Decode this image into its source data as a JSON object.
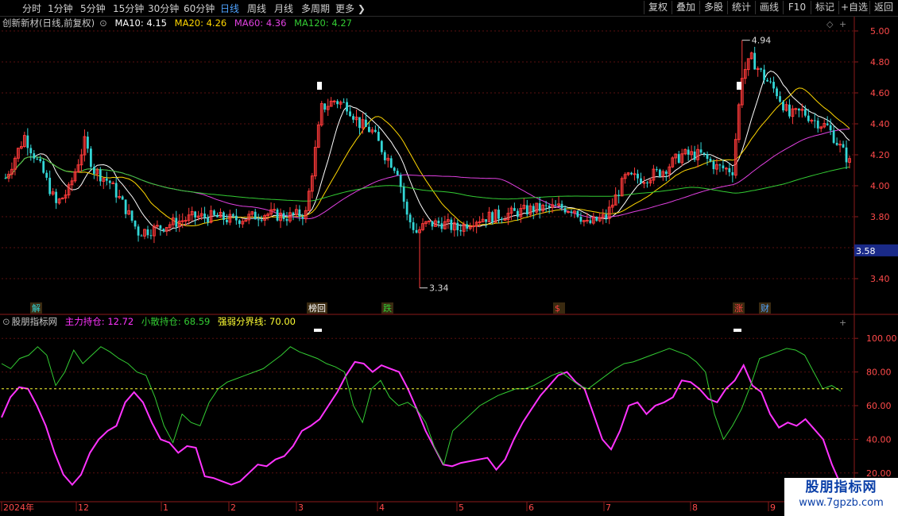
{
  "toolbar": {
    "timeframes": [
      "分时",
      "1分钟",
      "5分钟",
      "15分钟",
      "30分钟",
      "60分钟",
      "日线",
      "周线",
      "月线",
      "多周期",
      "更多"
    ],
    "active_timeframe": "日线",
    "right_buttons": [
      "复权",
      "叠加",
      "多股",
      "统计",
      "画线",
      "F10",
      "标记",
      "+自选",
      "返回"
    ]
  },
  "price_panel": {
    "stock_label": "创新新材(日线,前复权)",
    "ma": [
      {
        "label": "MA10: 4.15",
        "color": "#ffffff"
      },
      {
        "label": "MA20: 4.26",
        "color": "#ffd700"
      },
      {
        "label": "MA60: 4.36",
        "color": "#e040e0"
      },
      {
        "label": "MA120: 4.27",
        "color": "#33cc33"
      }
    ],
    "high_label": "4.94",
    "low_label": "3.34",
    "current_price": "3.58",
    "event_markers": [
      {
        "text": "解",
        "color": "#33d6d6"
      },
      {
        "text": "榜回",
        "color": "#ffffff"
      },
      {
        "text": "跌",
        "color": "#33cc33"
      },
      {
        "text": "$",
        "color": "#ff4040"
      },
      {
        "text": "涨",
        "color": "#ff4040"
      },
      {
        "text": "财",
        "color": "#4fa3ff"
      }
    ]
  },
  "indicator_panel": {
    "title": "股朋指标网",
    "series_labels": [
      {
        "label": "主力持仓: 12.72",
        "color": "#ff33ff"
      },
      {
        "label": "小散持仓: 68.59",
        "color": "#33cc33"
      },
      {
        "label": "强弱分界线: 70.00",
        "color": "#ffff33"
      }
    ]
  },
  "date_axis": [
    "2024年",
    "12",
    "1",
    "2",
    "3",
    "4",
    "5",
    "6",
    "7",
    "8",
    "9"
  ],
  "watermark": {
    "title": "股朋指标网",
    "url": "www.7gpzb.com"
  },
  "chart_data": [
    {
      "type": "candlestick",
      "y_axis_ticks": [
        5.0,
        4.8,
        4.6,
        4.4,
        4.2,
        4.0,
        3.8,
        3.4
      ],
      "ylim": [
        3.34,
        4.94
      ],
      "grid": true,
      "x_labels": [
        "2024年",
        "12",
        "1",
        "2",
        "3",
        "4",
        "5",
        "6",
        "7",
        "8",
        "9"
      ],
      "key_points": [
        {
          "label": "high",
          "value": 4.94
        },
        {
          "label": "low",
          "value": 3.34
        },
        {
          "label": "last",
          "value": 3.58
        }
      ],
      "series": [
        {
          "name": "MA10",
          "last": 4.15
        },
        {
          "name": "MA20",
          "last": 4.26
        },
        {
          "name": "MA60",
          "last": 4.36
        },
        {
          "name": "MA120",
          "last": 4.27
        }
      ]
    },
    {
      "type": "line",
      "y_axis_ticks": [
        100.0,
        80.0,
        60.0,
        40.0,
        20.0
      ],
      "ylim": [
        13,
        108
      ],
      "grid": true,
      "series": [
        {
          "name": "主力持仓",
          "color": "#ff33ff",
          "last": 12.72,
          "values": [
            53,
            65,
            71,
            70,
            60,
            48,
            32,
            19,
            12,
            19,
            32,
            40,
            45,
            48,
            62,
            68,
            62,
            50,
            40,
            38,
            32,
            36,
            35,
            18,
            17,
            15,
            11,
            15,
            20,
            25,
            24,
            28,
            30,
            36,
            45,
            48,
            52,
            60,
            68,
            78,
            86,
            85,
            80,
            84,
            82,
            80,
            70,
            58,
            45,
            35,
            25,
            24,
            26,
            27,
            28,
            29,
            22,
            28,
            40,
            50,
            58,
            66,
            72,
            78,
            80,
            74,
            70,
            55,
            40,
            34,
            45,
            60,
            62,
            55,
            60,
            62,
            65,
            75,
            74,
            70,
            64,
            62,
            70,
            75,
            84,
            72,
            68,
            55,
            47,
            50,
            48,
            52,
            46,
            40,
            25,
            12
          ]
        },
        {
          "name": "小散持仓",
          "color": "#33cc33",
          "last": 68.59,
          "values": [
            85,
            82,
            88,
            90,
            95,
            90,
            72,
            80,
            93,
            85,
            90,
            95,
            92,
            88,
            85,
            80,
            78,
            65,
            48,
            38,
            55,
            50,
            48,
            62,
            70,
            74,
            76,
            78,
            80,
            82,
            86,
            90,
            95,
            92,
            90,
            88,
            85,
            83,
            80,
            60,
            50,
            70,
            75,
            65,
            60,
            62,
            58,
            50,
            35,
            25,
            45,
            50,
            55,
            60,
            63,
            66,
            68,
            70,
            70,
            72,
            75,
            78,
            80,
            76,
            72,
            70,
            74,
            78,
            82,
            85,
            86,
            88,
            90,
            92,
            94,
            92,
            90,
            86,
            80,
            55,
            40,
            48,
            58,
            72,
            88,
            90,
            92,
            94,
            93,
            90,
            80,
            70,
            72,
            68.59
          ]
        },
        {
          "name": "强弱分界线",
          "color": "#ffff33",
          "last": 70.0,
          "constant": 70.0
        }
      ]
    }
  ]
}
